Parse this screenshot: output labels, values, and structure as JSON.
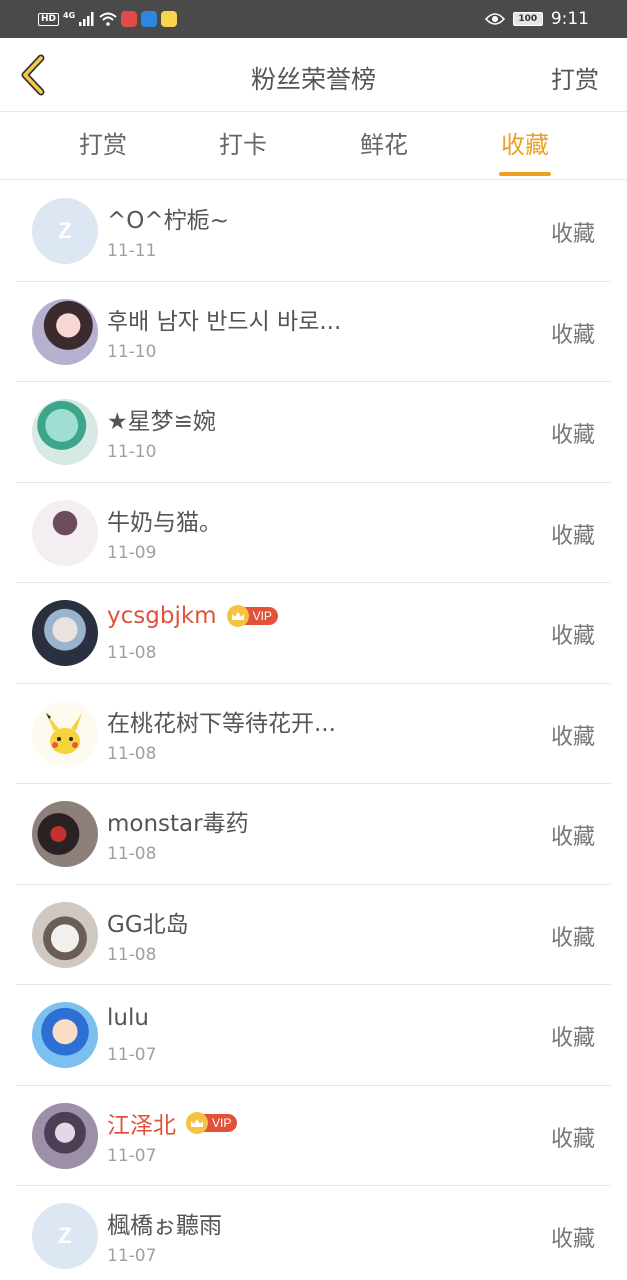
{
  "status_bar": {
    "hd": "HD",
    "net": "4G",
    "battery": "100",
    "time": "9:11"
  },
  "header": {
    "title": "粉丝荣誉榜",
    "action": "打赏",
    "back_icon": "chevron-left-icon"
  },
  "tabs": [
    {
      "label": "打赏",
      "active": false
    },
    {
      "label": "打卡",
      "active": false
    },
    {
      "label": "鲜花",
      "active": false
    },
    {
      "label": "收藏",
      "active": true
    }
  ],
  "accent_color": "#f0a020",
  "vip_color": "#e0533a",
  "vip_label": "VIP",
  "list": [
    {
      "name": "^O^柠栀~",
      "date": "11-11",
      "action": "收藏",
      "vip": false
    },
    {
      "name": "후배 남자 반드시 바로...",
      "date": "11-10",
      "action": "收藏",
      "vip": false
    },
    {
      "name": "★星梦≌婉",
      "date": "11-10",
      "action": "收藏",
      "vip": false
    },
    {
      "name": "牛奶与猫。",
      "date": "11-09",
      "action": "收藏",
      "vip": false
    },
    {
      "name": "ycsgbjkm",
      "date": "11-08",
      "action": "收藏",
      "vip": true
    },
    {
      "name": "在桃花树下等待花开...",
      "date": "11-08",
      "action": "收藏",
      "vip": false
    },
    {
      "name": "monstar毒药",
      "date": "11-08",
      "action": "收藏",
      "vip": false
    },
    {
      "name": "GG北岛",
      "date": "11-08",
      "action": "收藏",
      "vip": false
    },
    {
      "name": "lulu",
      "date": "11-07",
      "action": "收藏",
      "vip": false
    },
    {
      "name": "江泽北",
      "date": "11-07",
      "action": "收藏",
      "vip": true
    },
    {
      "name": "楓橋ぉ聽雨",
      "date": "11-07",
      "action": "收藏",
      "vip": false
    }
  ]
}
